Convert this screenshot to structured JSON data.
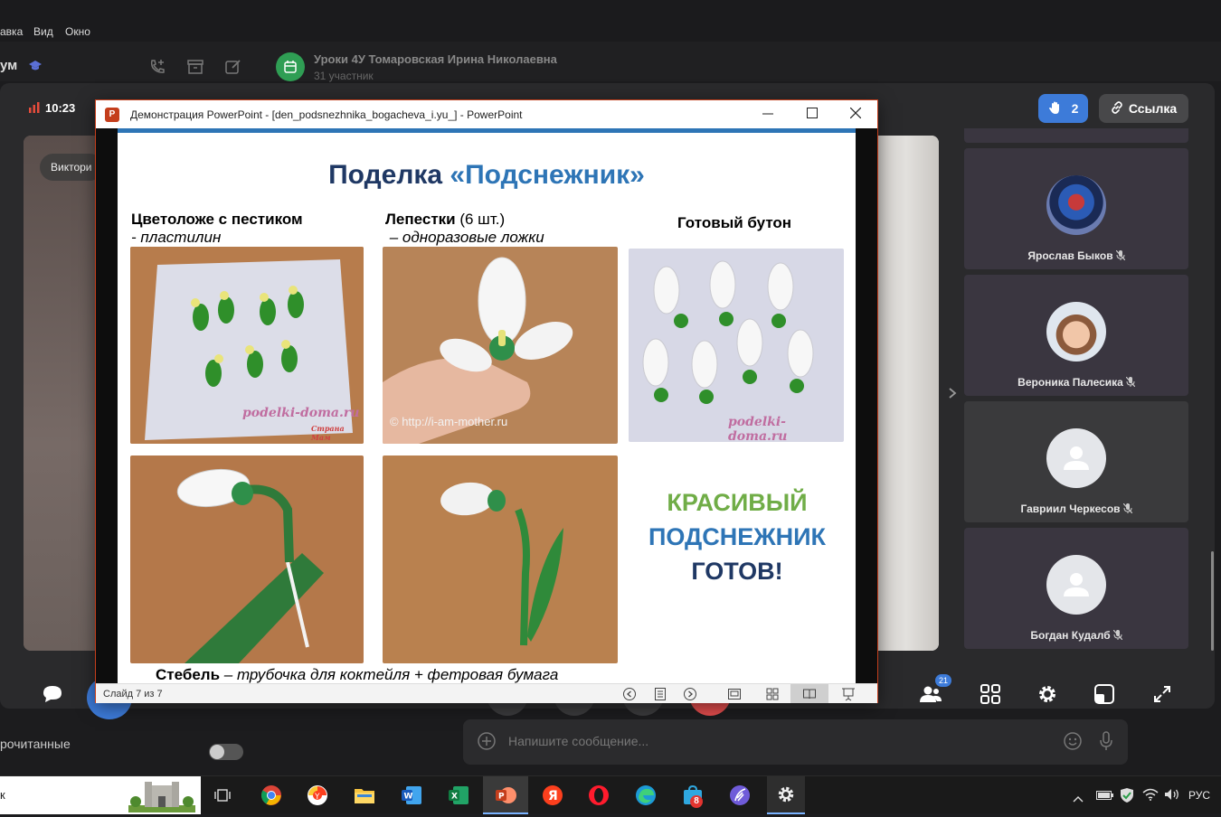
{
  "menu": {
    "items": [
      "авка",
      "Вид",
      "Окно"
    ]
  },
  "app": {
    "name_fragment": "ум",
    "chat_title": "Уроки 4У Томаровская Ирина Николаевна",
    "chat_subtitle": "31 участник"
  },
  "call": {
    "time": "10:23",
    "raised_hands": "2",
    "link_label": "Ссылка",
    "main_video_label": "Виктори",
    "participants": [
      {
        "name": "Ярослав Быков"
      },
      {
        "name": "Вероника Палесика"
      },
      {
        "name": "Гавриил Черкесов"
      },
      {
        "name": "Богдан Кудалб"
      }
    ],
    "participants_count": "21"
  },
  "ppt": {
    "window_title": "Демонстрация PowerPoint - [den_podsnezhnika_bogacheva_i.yu_] - PowerPoint",
    "status": "Слайд 7 из 7",
    "slide": {
      "title_prefix": "Поделка ",
      "title_accent": "«Подснежник»",
      "col1_title": "Цветоложе с пестиком",
      "col1_sub": "- пластилин",
      "col2_title": "Лепестки",
      "col2_count": " (6 шт.)",
      "col2_sub": "– одноразовые ложки",
      "col3_title": "Готовый бутон",
      "wm1": "podelki-doma.ru",
      "wm1b": "Страна Мам",
      "wm2": "© http://i-am-mother.ru",
      "wm3": "podelki-doma.ru",
      "final_line1": "КРАСИВЫЙ",
      "final_line2": "ПОДСНЕЖНИК",
      "final_line3": "ГОТОВ!",
      "bottom_title": "Стебель",
      "bottom_sub": " – трубочка для коктейля + фетровая бумага"
    }
  },
  "chat": {
    "input_placeholder": "Напишите сообщение...",
    "unread_label": "рочитанные"
  },
  "taskbar": {
    "search_fragment": "к",
    "store_badge": "8",
    "lang": "РУС"
  },
  "colors": {
    "accent_blue": "#2e75b6",
    "title_navy": "#1f3864",
    "final_green": "#70ad47",
    "final_blue": "#2e75b6",
    "hand_button": "#3d7bd9",
    "ppt_red": "#c43e1c"
  }
}
